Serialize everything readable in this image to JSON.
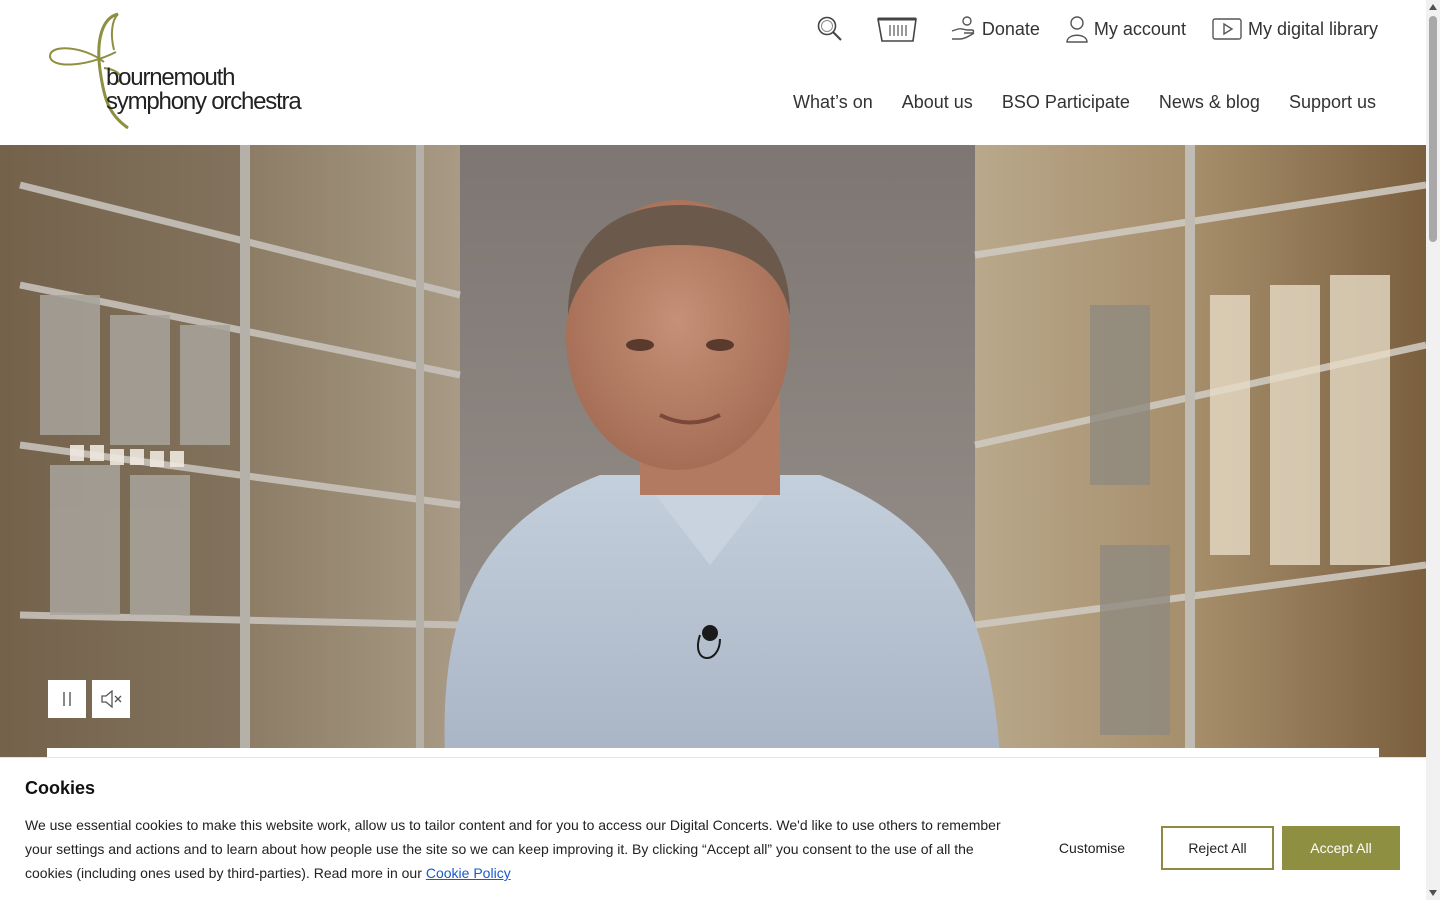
{
  "brand": {
    "line1": "bournemouth",
    "line2": "symphony orchestra",
    "accent": "#8f8f42"
  },
  "utility_nav": {
    "search_icon": "search-icon",
    "basket_icon": "basket-icon",
    "donate_label": "Donate",
    "account_label": "My account",
    "library_label": "My digital library"
  },
  "main_nav": [
    {
      "label": "What’s on"
    },
    {
      "label": "About us"
    },
    {
      "label": "BSO Participate"
    },
    {
      "label": "News & blog"
    },
    {
      "label": "Support us"
    }
  ],
  "video_controls": {
    "pause_icon": "pause-icon",
    "mute_icon": "muted-speaker-icon"
  },
  "cookie_banner": {
    "title": "Cookies",
    "body": "We use essential cookies to make this website work, allow us to tailor content and for you to access our Digital Concerts. We'd like to use others to remember your settings and actions and to learn about how people use the site so we can keep improving it. By clicking “Accept all” you consent to the use of all the cookies (including ones used by third-parties). Read more in our",
    "policy_link": "Cookie Policy",
    "customise_label": "Customise",
    "reject_label": "Reject All",
    "accept_label": "Accept All"
  }
}
